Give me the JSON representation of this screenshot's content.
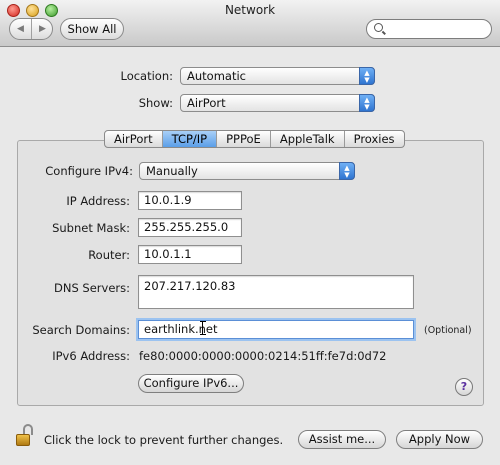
{
  "window": {
    "title": "Network"
  },
  "toolbar": {
    "back_icon": "◀",
    "forward_icon": "▶",
    "show_all_label": "Show All",
    "search_placeholder": ""
  },
  "location": {
    "label": "Location:",
    "value": "Automatic"
  },
  "show": {
    "label": "Show:",
    "value": "AirPort"
  },
  "tabs": [
    {
      "label": "AirPort",
      "active": false
    },
    {
      "label": "TCP/IP",
      "active": true
    },
    {
      "label": "PPPoE",
      "active": false
    },
    {
      "label": "AppleTalk",
      "active": false
    },
    {
      "label": "Proxies",
      "active": false
    }
  ],
  "tcpip": {
    "configure_label": "Configure IPv4:",
    "configure_value": "Manually",
    "ip_label": "IP Address:",
    "ip_value": "10.0.1.9",
    "subnet_label": "Subnet Mask:",
    "subnet_value": "255.255.255.0",
    "router_label": "Router:",
    "router_value": "10.0.1.1",
    "dns_label": "DNS Servers:",
    "dns_value": "207.217.120.83",
    "search_label": "Search Domains:",
    "search_value": "earthlink.net",
    "optional_note": "(Optional)",
    "ipv6_label": "IPv6 Address:",
    "ipv6_value": "fe80:0000:0000:0000:0214:51ff:fe7d:0d72",
    "configure_ipv6_button": "Configure IPv6...",
    "help_label": "?"
  },
  "footer": {
    "lock_text": "Click the lock to prevent further changes.",
    "assist_button": "Assist me...",
    "apply_button": "Apply Now"
  },
  "colors": {
    "accent": "#3f84dd",
    "active_tab": "#5b9ee8",
    "focus_ring": "#9cc3f0"
  }
}
